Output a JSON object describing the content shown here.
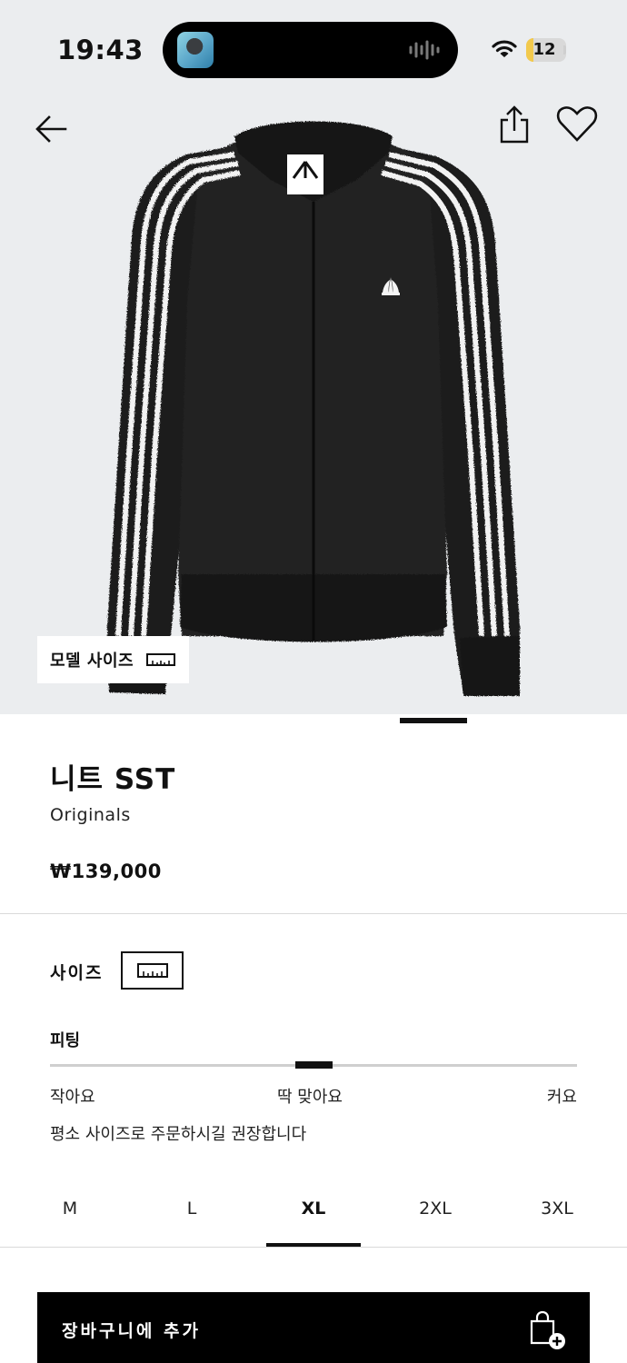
{
  "status_bar": {
    "time": "19:43",
    "battery": "12",
    "battery_fraction": 0.12
  },
  "header": {
    "back_icon": "arrow-left-icon",
    "share_icon": "share-icon",
    "wishlist_icon": "heart-icon"
  },
  "gallery": {
    "model_size_label": "모델 사이즈",
    "model_size_icon": "ruler-icon"
  },
  "product": {
    "title": "니트 SST",
    "brand": "Originals",
    "price": "₩139,000"
  },
  "size_section": {
    "heading": "사이즈",
    "guide_icon": "ruler-icon",
    "fit": {
      "heading": "피팅",
      "position": 0.5,
      "labels": {
        "small": "작아요",
        "true_to_size": "딱 맞아요",
        "large": "커요"
      },
      "recommendation": "평소 사이즈로 주문하시길 권장합니다"
    },
    "sizes": [
      "M",
      "L",
      "XL",
      "2XL",
      "3XL"
    ],
    "selected_size": "XL"
  },
  "cta": {
    "add_to_bag_label": "장바구니에 추가",
    "icon": "bag-plus-icon"
  },
  "colors": {
    "background": "#ebedef",
    "primary": "#000000",
    "battery": "#f2c94c"
  }
}
